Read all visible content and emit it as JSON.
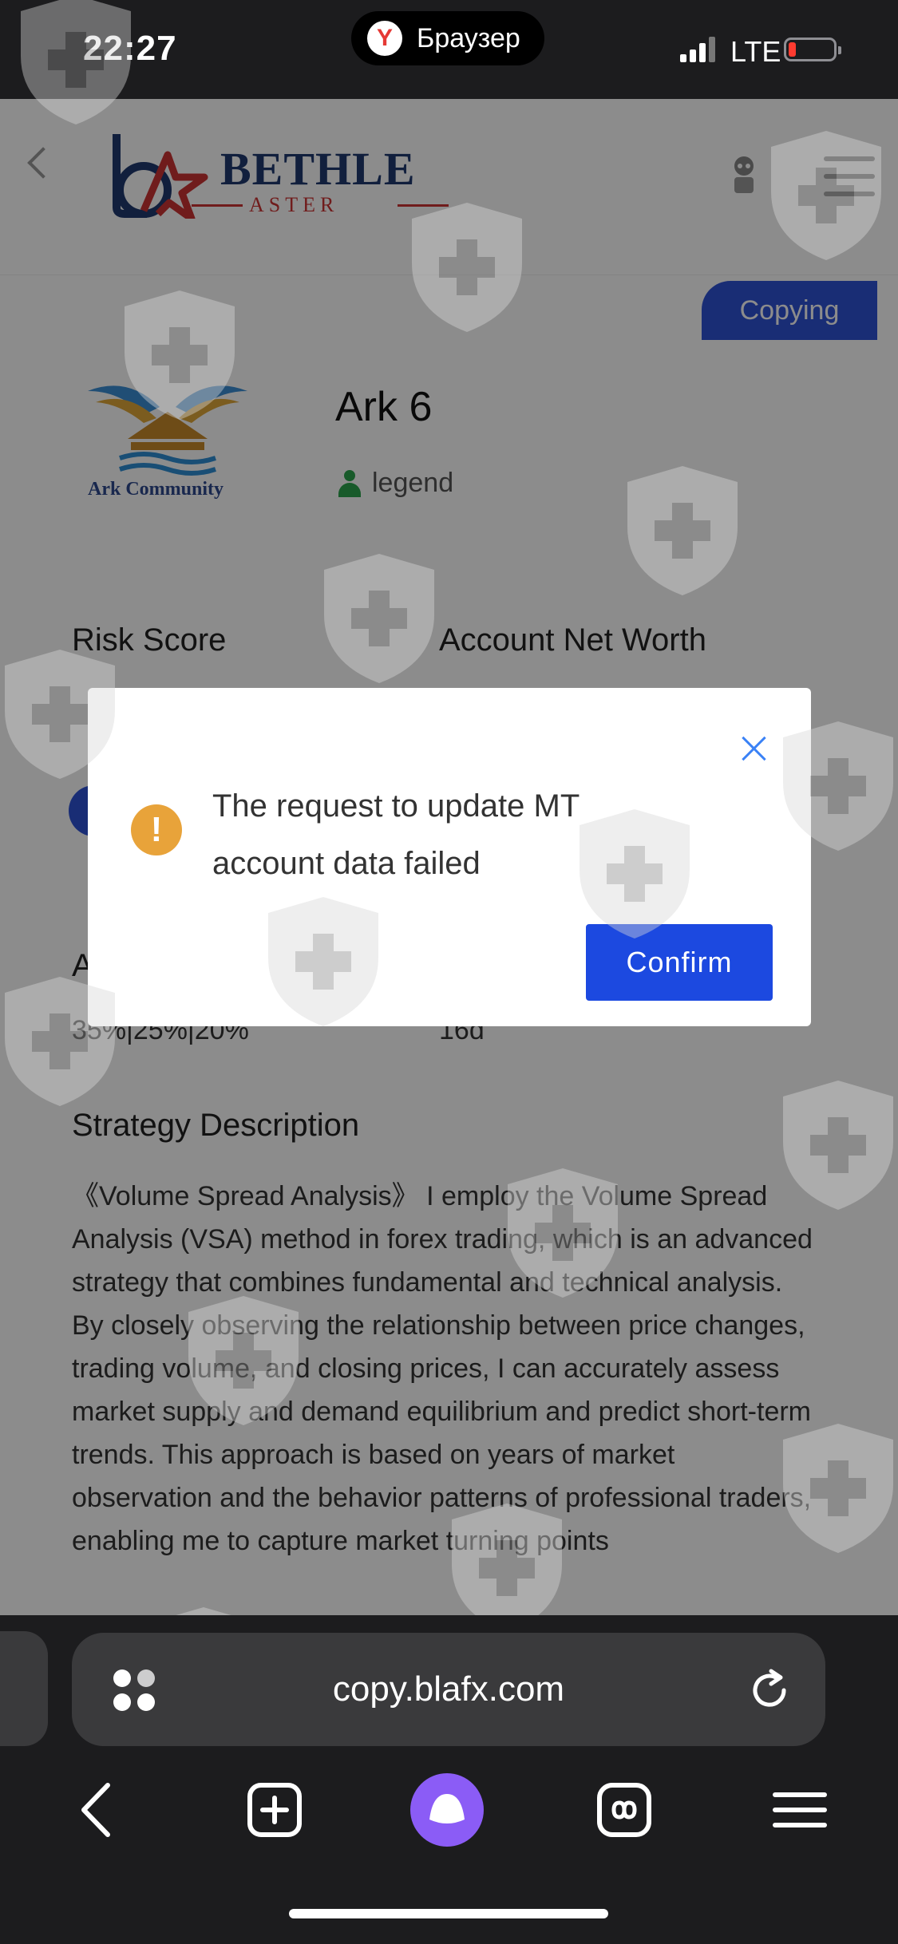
{
  "status_bar": {
    "time": "22:27",
    "browser_name": "Браузер",
    "network": "LTE"
  },
  "header": {
    "logo_word": "BETHLE",
    "logo_sub": "ASTER"
  },
  "trader": {
    "badge": "Copying",
    "avatar_text": "Ark Community",
    "name": "Ark 6",
    "level": "legend"
  },
  "stats": {
    "risk_label": "Risk Score",
    "net_worth_label": "Account Net Worth",
    "hidden_label_initial": "A",
    "allocation_value": "35%|25%|20%",
    "days_value": "16d"
  },
  "strategy": {
    "title": "Strategy Description",
    "text": "《Volume Spread Analysis》 I employ the Volume Spread Analysis (VSA) method in forex trading, which is an advanced strategy that combines fundamental and technical analysis. By closely observing the relationship between price changes, trading volume, and closing prices, I can accurately assess market supply and demand equilibrium and predict short-term trends. This approach is based on years of market observation and the behavior patterns of professional traders, enabling me to capture market turning points"
  },
  "dialog": {
    "message": "The request to update MT account data failed",
    "confirm_label": "Confirm"
  },
  "browser": {
    "url": "copy.blafx.com"
  },
  "colors": {
    "accent": "#1c49e0",
    "warning": "#e8a33a",
    "legend": "#2da44e"
  }
}
